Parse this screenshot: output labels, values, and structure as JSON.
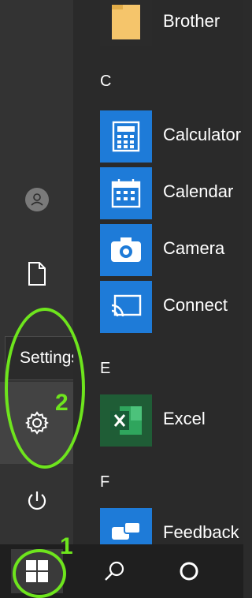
{
  "start_menu": {
    "groups": [
      {
        "letter": "C"
      },
      {
        "letter": "E"
      },
      {
        "letter": "F"
      }
    ],
    "apps": [
      {
        "label": "Brother",
        "tile_color": "#2b2b2b",
        "icon": "folder-icon"
      },
      {
        "label": "Calculator",
        "tile_color": "#1e7bd8",
        "icon": "calculator-icon"
      },
      {
        "label": "Calendar",
        "tile_color": "#1e7bd8",
        "icon": "calendar-icon"
      },
      {
        "label": "Camera",
        "tile_color": "#1e7bd8",
        "icon": "camera-icon"
      },
      {
        "label": "Connect",
        "tile_color": "#1e7bd8",
        "icon": "connect-icon"
      },
      {
        "label": "Excel",
        "tile_color": "#1f5d36",
        "icon": "excel-icon"
      },
      {
        "label": "Feedback",
        "tile_color": "#1e7bd8",
        "icon": "feedback-icon"
      }
    ]
  },
  "rail": {
    "tooltip": "Settings",
    "icons": [
      "user-avatar-icon",
      "document-icon",
      "gear-icon",
      "power-icon"
    ]
  },
  "taskbar": {
    "icons": [
      "windows-start-icon",
      "search-icon",
      "cortana-icon"
    ]
  },
  "annotations": {
    "step_1": "1",
    "step_2": "2",
    "highlight_color": "#6ee51d"
  }
}
